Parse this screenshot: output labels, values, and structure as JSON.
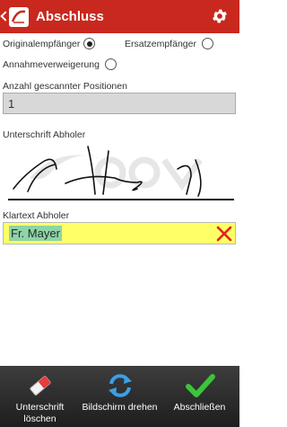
{
  "appbar": {
    "title": "Abschluss"
  },
  "options": {
    "originalempfaenger": "Originalempfänger",
    "ersatzempfaenger": "Ersatzempfänger",
    "annahmeverweigerung": "Annahmeverweigerung",
    "selected": "originalempfaenger"
  },
  "count": {
    "label": "Anzahl gescannter Positionen",
    "value": "1"
  },
  "signature": {
    "label": "Unterschrift Abholer"
  },
  "cleartext": {
    "label": "Klartext Abholer",
    "value": "Fr. Mayer"
  },
  "bottom": {
    "clear_signature": "Unterschrift löschen",
    "rotate_screen": "Bildschirm drehen",
    "finish": "Abschließen"
  }
}
